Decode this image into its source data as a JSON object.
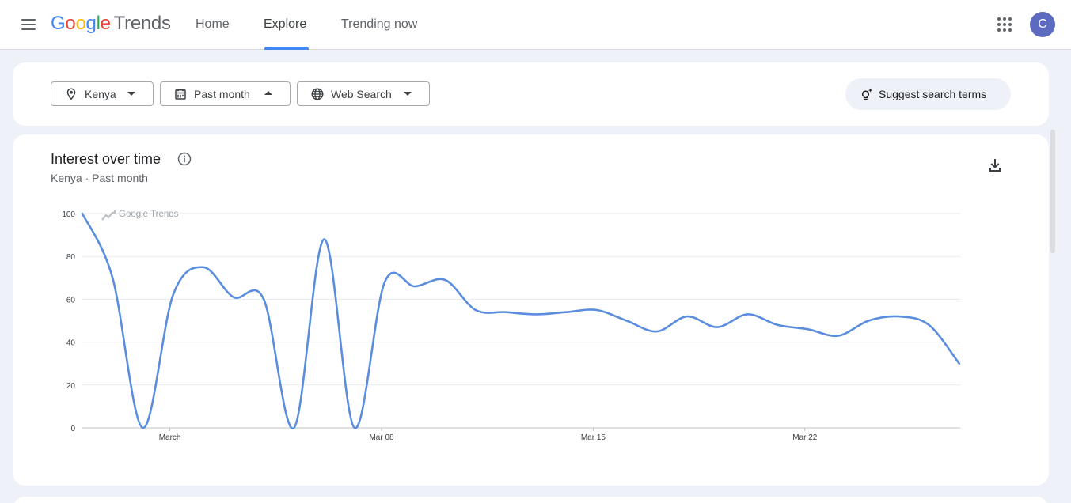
{
  "header": {
    "logo_letters": [
      {
        "ch": "G",
        "color": "#4285F4"
      },
      {
        "ch": "o",
        "color": "#EA4335"
      },
      {
        "ch": "o",
        "color": "#FBBC05"
      },
      {
        "ch": "g",
        "color": "#4285F4"
      },
      {
        "ch": "l",
        "color": "#34A853"
      },
      {
        "ch": "e",
        "color": "#EA4335"
      }
    ],
    "logo_suffix": "Trends",
    "tabs": [
      {
        "label": "Home",
        "active": false
      },
      {
        "label": "Explore",
        "active": true
      },
      {
        "label": "Trending now",
        "active": false
      }
    ],
    "avatar_initial": "C",
    "menu_icon": "hamburger-menu-icon",
    "apps_icon": "apps-grid-icon",
    "accent_color": "#4285F4",
    "avatar_color": "#5C6BC0"
  },
  "filters": {
    "location": {
      "label": "Kenya",
      "icon": "location-pin-icon"
    },
    "time_range": {
      "label": "Past month",
      "icon": "calendar-icon",
      "expanded": true
    },
    "search_type": {
      "label": "Web Search",
      "icon": "globe-icon"
    },
    "suggest_button": {
      "label": "Suggest search terms",
      "icon": "sparkle-lightbulb-icon"
    }
  },
  "interest_card": {
    "title": "Interest over time",
    "subtitle": "Kenya · Past month",
    "watermark": "Google Trends",
    "info_icon": "info-icon",
    "download_icon": "download-icon"
  },
  "chart_data": {
    "type": "line",
    "title": "Interest over time",
    "xlabel": "",
    "ylabel": "",
    "ylim": [
      0,
      100
    ],
    "yticks": [
      0,
      20,
      40,
      60,
      80,
      100
    ],
    "xtick_labels": [
      {
        "label": "March",
        "day": 1
      },
      {
        "label": "Mar 08",
        "day": 8
      },
      {
        "label": "Mar 15",
        "day": 15
      },
      {
        "label": "Mar 22",
        "day": 22
      }
    ],
    "grid": true,
    "line_color": "#5B8DDE",
    "series": [
      {
        "x": [
          "Feb 26",
          "Feb 27",
          "Feb 28",
          "Mar 1",
          "Mar 2",
          "Mar 3",
          "Mar 4",
          "Mar 5",
          "Mar 6",
          "Mar 7",
          "Mar 8",
          "Mar 9",
          "Mar 10",
          "Mar 11",
          "Mar 12",
          "Mar 13",
          "Mar 14",
          "Mar 15",
          "Mar 16",
          "Mar 17",
          "Mar 18",
          "Mar 19",
          "Mar 20",
          "Mar 21",
          "Mar 22",
          "Mar 23",
          "Mar 24",
          "Mar 25",
          "Mar 26",
          "Mar 27"
        ],
        "values": [
          100,
          70,
          0,
          62,
          75,
          61,
          60,
          0,
          88,
          0,
          68,
          66,
          69,
          55,
          54,
          53,
          54,
          55,
          50,
          45,
          52,
          47,
          53,
          48,
          46,
          43,
          50,
          52,
          48,
          30
        ]
      }
    ]
  }
}
